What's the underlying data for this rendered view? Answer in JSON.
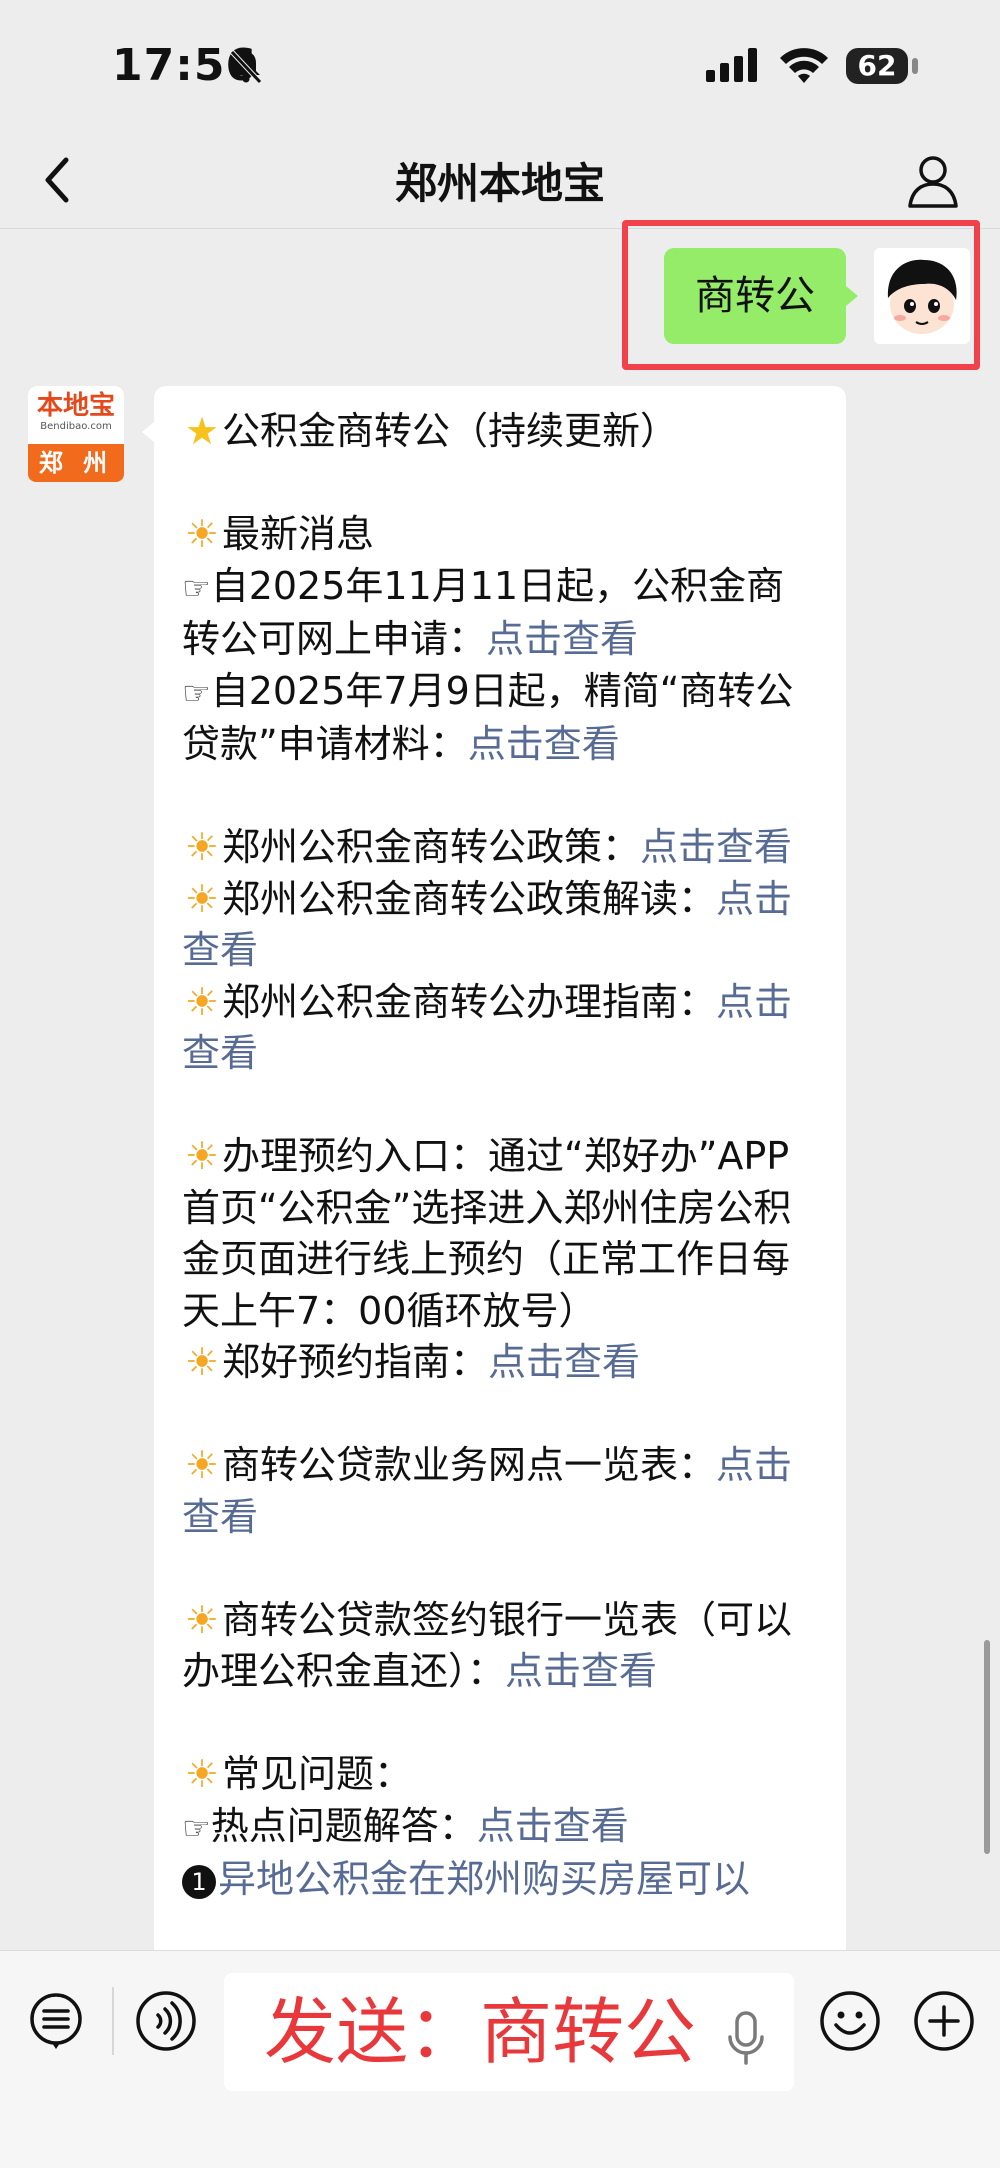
{
  "status_bar": {
    "time": "17:56",
    "battery": "62"
  },
  "header": {
    "title": "郑州本地宝"
  },
  "outgoing": {
    "text": "商转公"
  },
  "bot_avatar": {
    "top": "本地宝",
    "url": "Bendibao.com",
    "city": "郑 州"
  },
  "incoming": {
    "lines": {
      "title": "公积金商转公（持续更新）",
      "news_heading": "最新消息",
      "news1_text": "自2025年11月11日起，公积金商转公可网上申请：",
      "news1_link": "点击查看",
      "news2_text": "自2025年7月9日起，精简“商转公贷款”申请材料：",
      "news2_link": "点击查看",
      "policy_text": "郑州公积金商转公政策：",
      "policy_link": "点击查看",
      "interp_text": "郑州公积金商转公政策解读：",
      "interp_link": "点击查看",
      "guide_text": "郑州公积金商转公办理指南：",
      "guide_link": "点击查看",
      "appoint_text": "办理预约入口：通过“郑好办”APP首页“公积金”选择进入郑州住房公积金页面进行线上预约（正常工作日每天上午7：00循环放号）",
      "appoint_guide_text": "郑好预约指南：",
      "appoint_guide_link": "点击查看",
      "outlets_text": "商转公贷款业务网点一览表：",
      "outlets_link": "点击查看",
      "banks_text": "商转公贷款签约银行一览表（可以办理公积金直还）：",
      "banks_link": "点击查看",
      "faq_heading": "常见问题：",
      "faq1_text": "热点问题解答：",
      "faq1_link": "点击查看",
      "faq2_num": "1",
      "faq2_link": "异地公积金在郑州购买房屋可以"
    }
  },
  "input": {
    "text": "发送：商转公"
  }
}
